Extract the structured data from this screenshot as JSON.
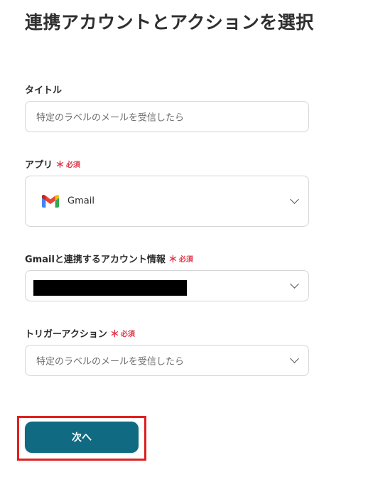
{
  "page": {
    "title": "連携アカウントとアクションを選択"
  },
  "form": {
    "title_field": {
      "label": "タイトル",
      "value": "特定のラベルのメールを受信したら"
    },
    "app_field": {
      "label": "アプリ",
      "required_mark": "＊",
      "required_text": "必須",
      "selected_value": "Gmail",
      "icon": "gmail-logo"
    },
    "account_field": {
      "label": "Gmailと連携するアカウント情報",
      "required_mark": "＊",
      "required_text": "必須",
      "value_redacted": true
    },
    "trigger_field": {
      "label": "トリガーアクション",
      "required_mark": "＊",
      "required_text": "必須",
      "selected_value": "特定のラベルのメールを受信したら"
    }
  },
  "actions": {
    "next_label": "次へ"
  },
  "colors": {
    "primary": "#0f6a82",
    "required": "#e03a4c",
    "highlight": "#e02020"
  }
}
